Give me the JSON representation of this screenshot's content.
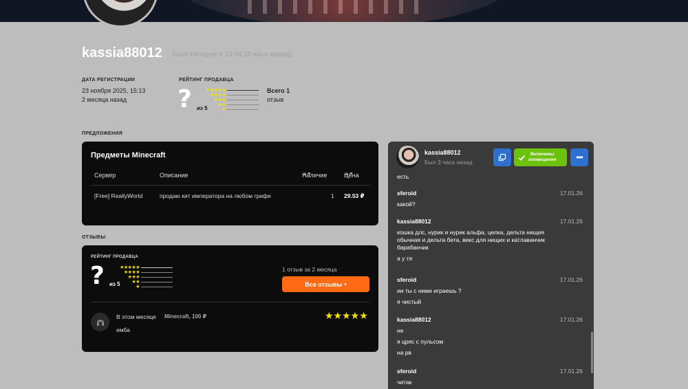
{
  "profile": {
    "username": "kassia88012",
    "last_seen": "Был сегодня в 13:02 (3 часа назад)",
    "registration_label": "ДАТА РЕГИСТРАЦИИ",
    "registration_date": "23 ноября 2025, 15:13",
    "registration_ago": "2 месяца назад",
    "rating_label": "РЕЙТИНГ ПРОДАВЦА",
    "rating_value": "?",
    "rating_of": "из 5",
    "total_label": "Всего 1",
    "total_sub": "отзыв",
    "star_rows": [
      "★★★★★",
      "★★★★",
      "★★★",
      "★★",
      "★"
    ]
  },
  "offers": {
    "section_label": "ПРЕДЛОЖЕНИЯ",
    "title": "Предметы Minecraft",
    "columns": {
      "server": "Сервер",
      "description": "Описание",
      "stock": "Наличие",
      "price": "Цена"
    },
    "rows": [
      {
        "server": "[Free] ReallyWorld",
        "description": "продаю кит императора на любом грифе",
        "stock": "1",
        "price": "29.53 ₽"
      }
    ]
  },
  "reviews": {
    "section_label": "ОТЗЫВЫ",
    "rating_label": "РЕЙТИНГ ПРОДАВЦА",
    "rating_value": "?",
    "rating_of": "из 5",
    "count_text": "1 отзыв за 2 месяца",
    "all_button": "Все отзывы",
    "items": [
      {
        "period": "В этом месяце",
        "game": "Minecraft, 100 ₽",
        "text": "имба",
        "stars": "★★★★★"
      }
    ]
  },
  "chat": {
    "name": "kassia88012",
    "seen": "Был 3 часа назад",
    "notifications_label_1": "Включены",
    "notifications_label_2": "оповещения",
    "first_line": "есть",
    "messages": [
      {
        "author": "sferoid",
        "date": "17.01.26",
        "lines": [
          "какой?"
        ]
      },
      {
        "author": "kassia88012",
        "date": "17.01.26",
        "lines": [
          "кошка длс, нурик и нурик альфа, целка, дельта нищия обычная и дельта бета, векс для нищих и катлаванчик барабанчик",
          "а у тя"
        ]
      },
      {
        "author": "sferoid",
        "date": "17.01.26",
        "lines": [
          "ии ты с ними играешь ?",
          "я чистый"
        ]
      },
      {
        "author": "kassia88012",
        "date": "17.01.26",
        "lines": [
          "не",
          "я цряс с пульсом",
          "на рв"
        ]
      },
      {
        "author": "sferoid",
        "date": "17.01.26",
        "lines": [
          "читак"
        ]
      }
    ]
  },
  "colors": {
    "accent_orange": "#ff6a13",
    "notif_green": "#6cc20f",
    "button_blue": "#2f6fd0",
    "star_yellow": "#f3e200"
  }
}
